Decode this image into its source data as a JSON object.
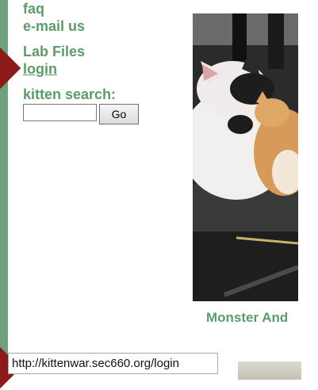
{
  "nav": {
    "faq": "faq",
    "email": "e-mail us",
    "lab_files": "Lab Files",
    "login": "login"
  },
  "search": {
    "label": "kitten search:",
    "value": "",
    "go_label": "Go"
  },
  "photo": {
    "caption": "Monster And"
  },
  "status_bar": {
    "url": "http://kittenwar.sec660.org/login"
  },
  "colors": {
    "link_green": "#5f9a6b",
    "sidebar_green": "#6fa27a",
    "arrow_red": "#8b1a1a"
  }
}
